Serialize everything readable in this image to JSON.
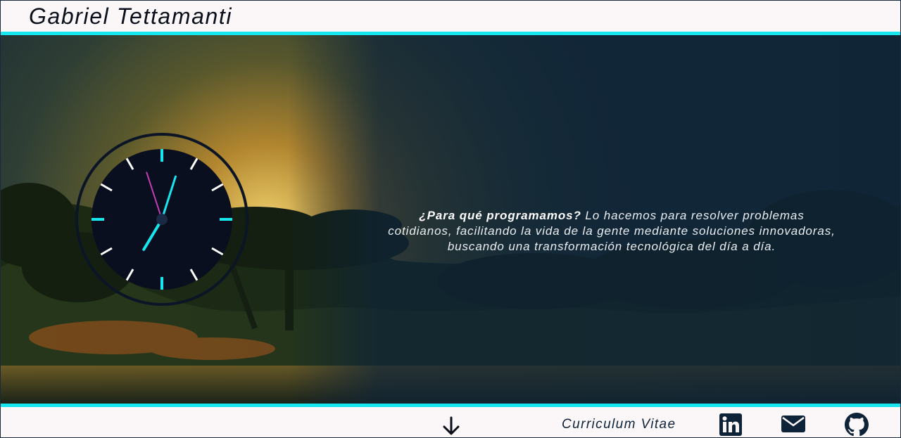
{
  "header": {
    "title": "Gabriel Tettamanti"
  },
  "hero": {
    "tagline_strong": "¿Para qué programamos?",
    "tagline_text": " Lo hacemos para resolver problemas cotidianos, facilitando la vida de la gente mediante soluciones innovadoras, buscando una transformación tecnológica del día a día."
  },
  "clock": {
    "hours": 7,
    "minutes": 2,
    "seconds": 57
  },
  "footer": {
    "cv_label": "Curriculum Vitae",
    "icons": [
      "arrow-down-icon",
      "linkedin-icon",
      "mail-icon",
      "github-icon"
    ]
  },
  "colors": {
    "accent": "#16e6ee",
    "header_bg": "#fbf7f9",
    "clock_face": "#0a0f1f",
    "clock_ring": "#0b1526",
    "hand_minute": "#16e6ee",
    "hand_hour": "#16e6ee",
    "hand_second": "#c23fb5",
    "icon_color": "#0e2238"
  }
}
